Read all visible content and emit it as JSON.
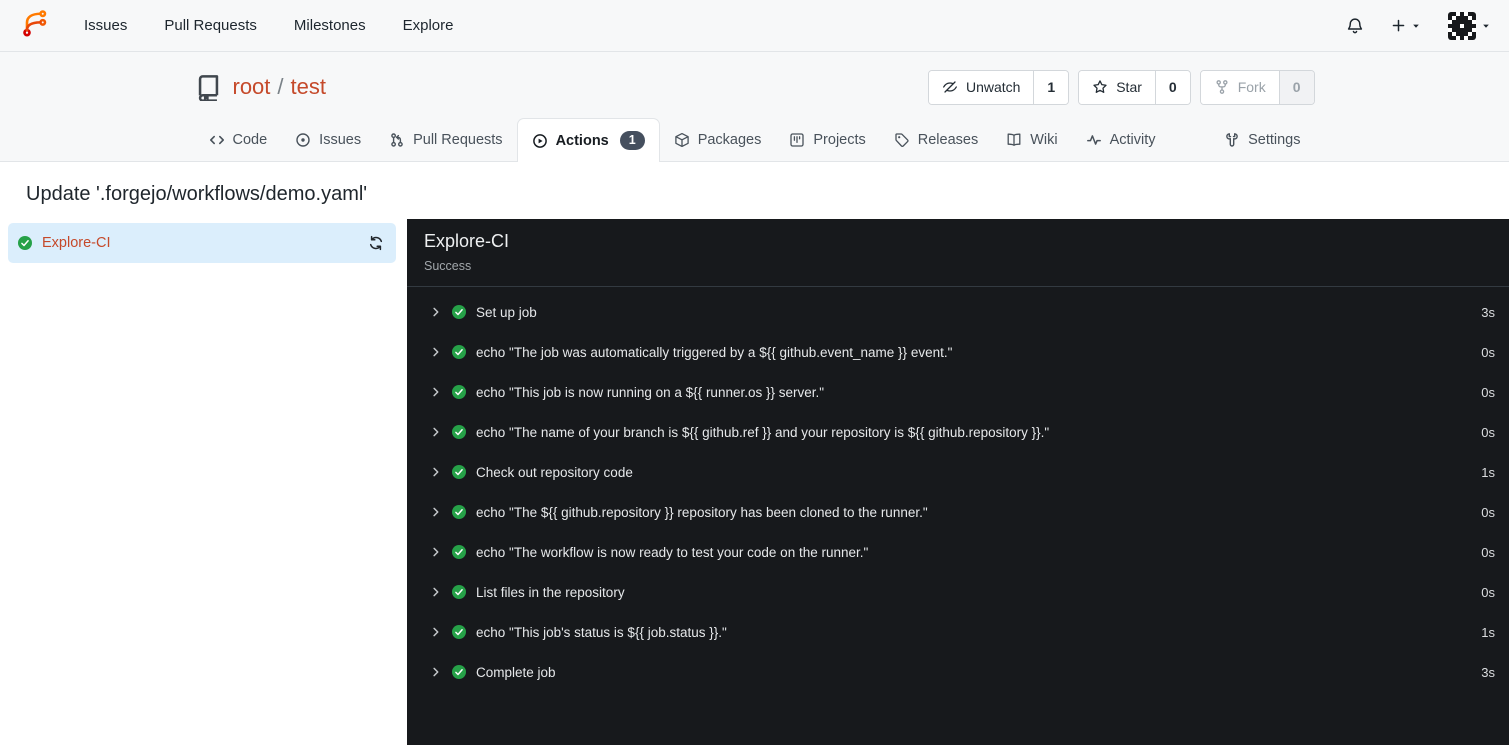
{
  "colors": {
    "accent": "#c5492a",
    "success": "#26a148",
    "selection": "#dbeefc",
    "panel": "#17191c",
    "badge": "#454f5e"
  },
  "navbar": {
    "logo_icon": "forgejo-logo",
    "links": [
      "Issues",
      "Pull Requests",
      "Milestones",
      "Explore"
    ],
    "right_icons": [
      "bell",
      "plus",
      "caret-down",
      "avatar"
    ]
  },
  "repo": {
    "icon": "repo",
    "owner": "root",
    "separator": "/",
    "name": "test",
    "buttons": [
      {
        "icon": "eye-slash",
        "label": "Unwatch",
        "count": "1",
        "disabled": false
      },
      {
        "icon": "star",
        "label": "Star",
        "count": "0",
        "disabled": false
      },
      {
        "icon": "fork",
        "label": "Fork",
        "count": "0",
        "disabled": true
      }
    ],
    "tabs": [
      {
        "icon": "code",
        "label": "Code",
        "active": false
      },
      {
        "icon": "issue",
        "label": "Issues",
        "active": false
      },
      {
        "icon": "pull-request",
        "label": "Pull Requests",
        "active": false
      },
      {
        "icon": "play-circle",
        "label": "Actions",
        "active": true,
        "badge": "1"
      },
      {
        "icon": "package",
        "label": "Packages",
        "active": false
      },
      {
        "icon": "project",
        "label": "Projects",
        "active": false
      },
      {
        "icon": "tag",
        "label": "Releases",
        "active": false
      },
      {
        "icon": "book",
        "label": "Wiki",
        "active": false
      },
      {
        "icon": "pulse",
        "label": "Activity",
        "active": false
      }
    ],
    "settings_tab": {
      "icon": "tools",
      "label": "Settings"
    }
  },
  "page": {
    "title": "Update '.forgejo/workflows/demo.yaml'"
  },
  "jobs": [
    {
      "label": "Explore-CI",
      "status": "success"
    }
  ],
  "panel": {
    "title": "Explore-CI",
    "status": "Success",
    "steps": [
      {
        "name": "Set up job",
        "duration": "3s"
      },
      {
        "name": "echo \"The job was automatically triggered by a ${{ github.event_name }} event.\"",
        "duration": "0s"
      },
      {
        "name": "echo \"This job is now running on a ${{ runner.os }} server.\"",
        "duration": "0s"
      },
      {
        "name": "echo \"The name of your branch is ${{ github.ref }} and your repository is ${{ github.repository }}.\"",
        "duration": "0s"
      },
      {
        "name": "Check out repository code",
        "duration": "1s"
      },
      {
        "name": "echo \"The ${{ github.repository }} repository has been cloned to the runner.\"",
        "duration": "0s"
      },
      {
        "name": "echo \"The workflow is now ready to test your code on the runner.\"",
        "duration": "0s"
      },
      {
        "name": "List files in the repository",
        "duration": "0s"
      },
      {
        "name": "echo \"This job's status is ${{ job.status }}.\"",
        "duration": "1s"
      },
      {
        "name": "Complete job",
        "duration": "3s"
      }
    ]
  }
}
